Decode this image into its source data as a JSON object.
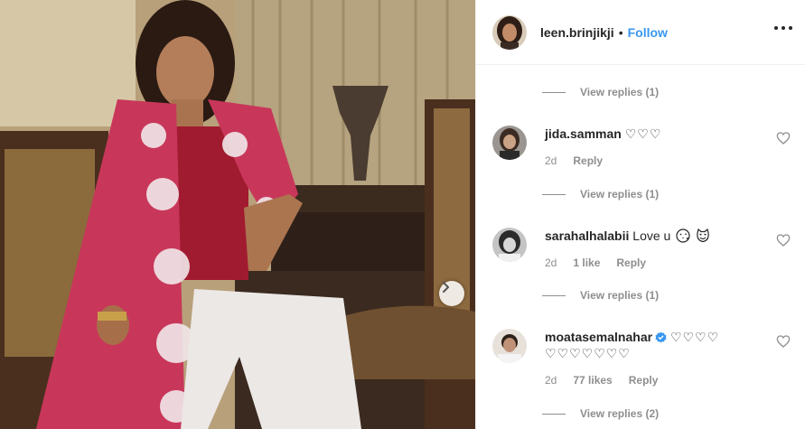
{
  "post": {
    "username": "leen.brinjikji",
    "separator": "•",
    "follow_label": "Follow"
  },
  "icons": {
    "more": "more-options-icon",
    "heart": "heart-outline-icon",
    "next": "chevron-right-icon",
    "verified": "verified-badge-icon"
  },
  "colors": {
    "link": "#3897f0",
    "muted": "#8e8e8e",
    "text": "#262626",
    "verified": "#3897f0"
  },
  "comments": [
    {
      "replies_label": "View replies (1)"
    },
    {
      "username": "jida.samman",
      "text": "♡♡♡",
      "time": "2d",
      "likes": "",
      "reply_label": "Reply",
      "replies_label": "View replies (1)"
    },
    {
      "username": "sarahalhalabii",
      "text": "Love u",
      "emojis": [
        "face-blowing-kiss-emoji",
        "heart-eyes-cat-emoji"
      ],
      "time": "2d",
      "likes": "1 like",
      "reply_label": "Reply",
      "replies_label": "View replies (1)"
    },
    {
      "username": "moatasemalnahar",
      "verified": true,
      "text": "♡♡♡♡",
      "text_line2": "♡♡♡♡♡♡♡",
      "time": "2d",
      "likes": "77 likes",
      "reply_label": "Reply",
      "replies_label": "View replies (2)"
    }
  ]
}
